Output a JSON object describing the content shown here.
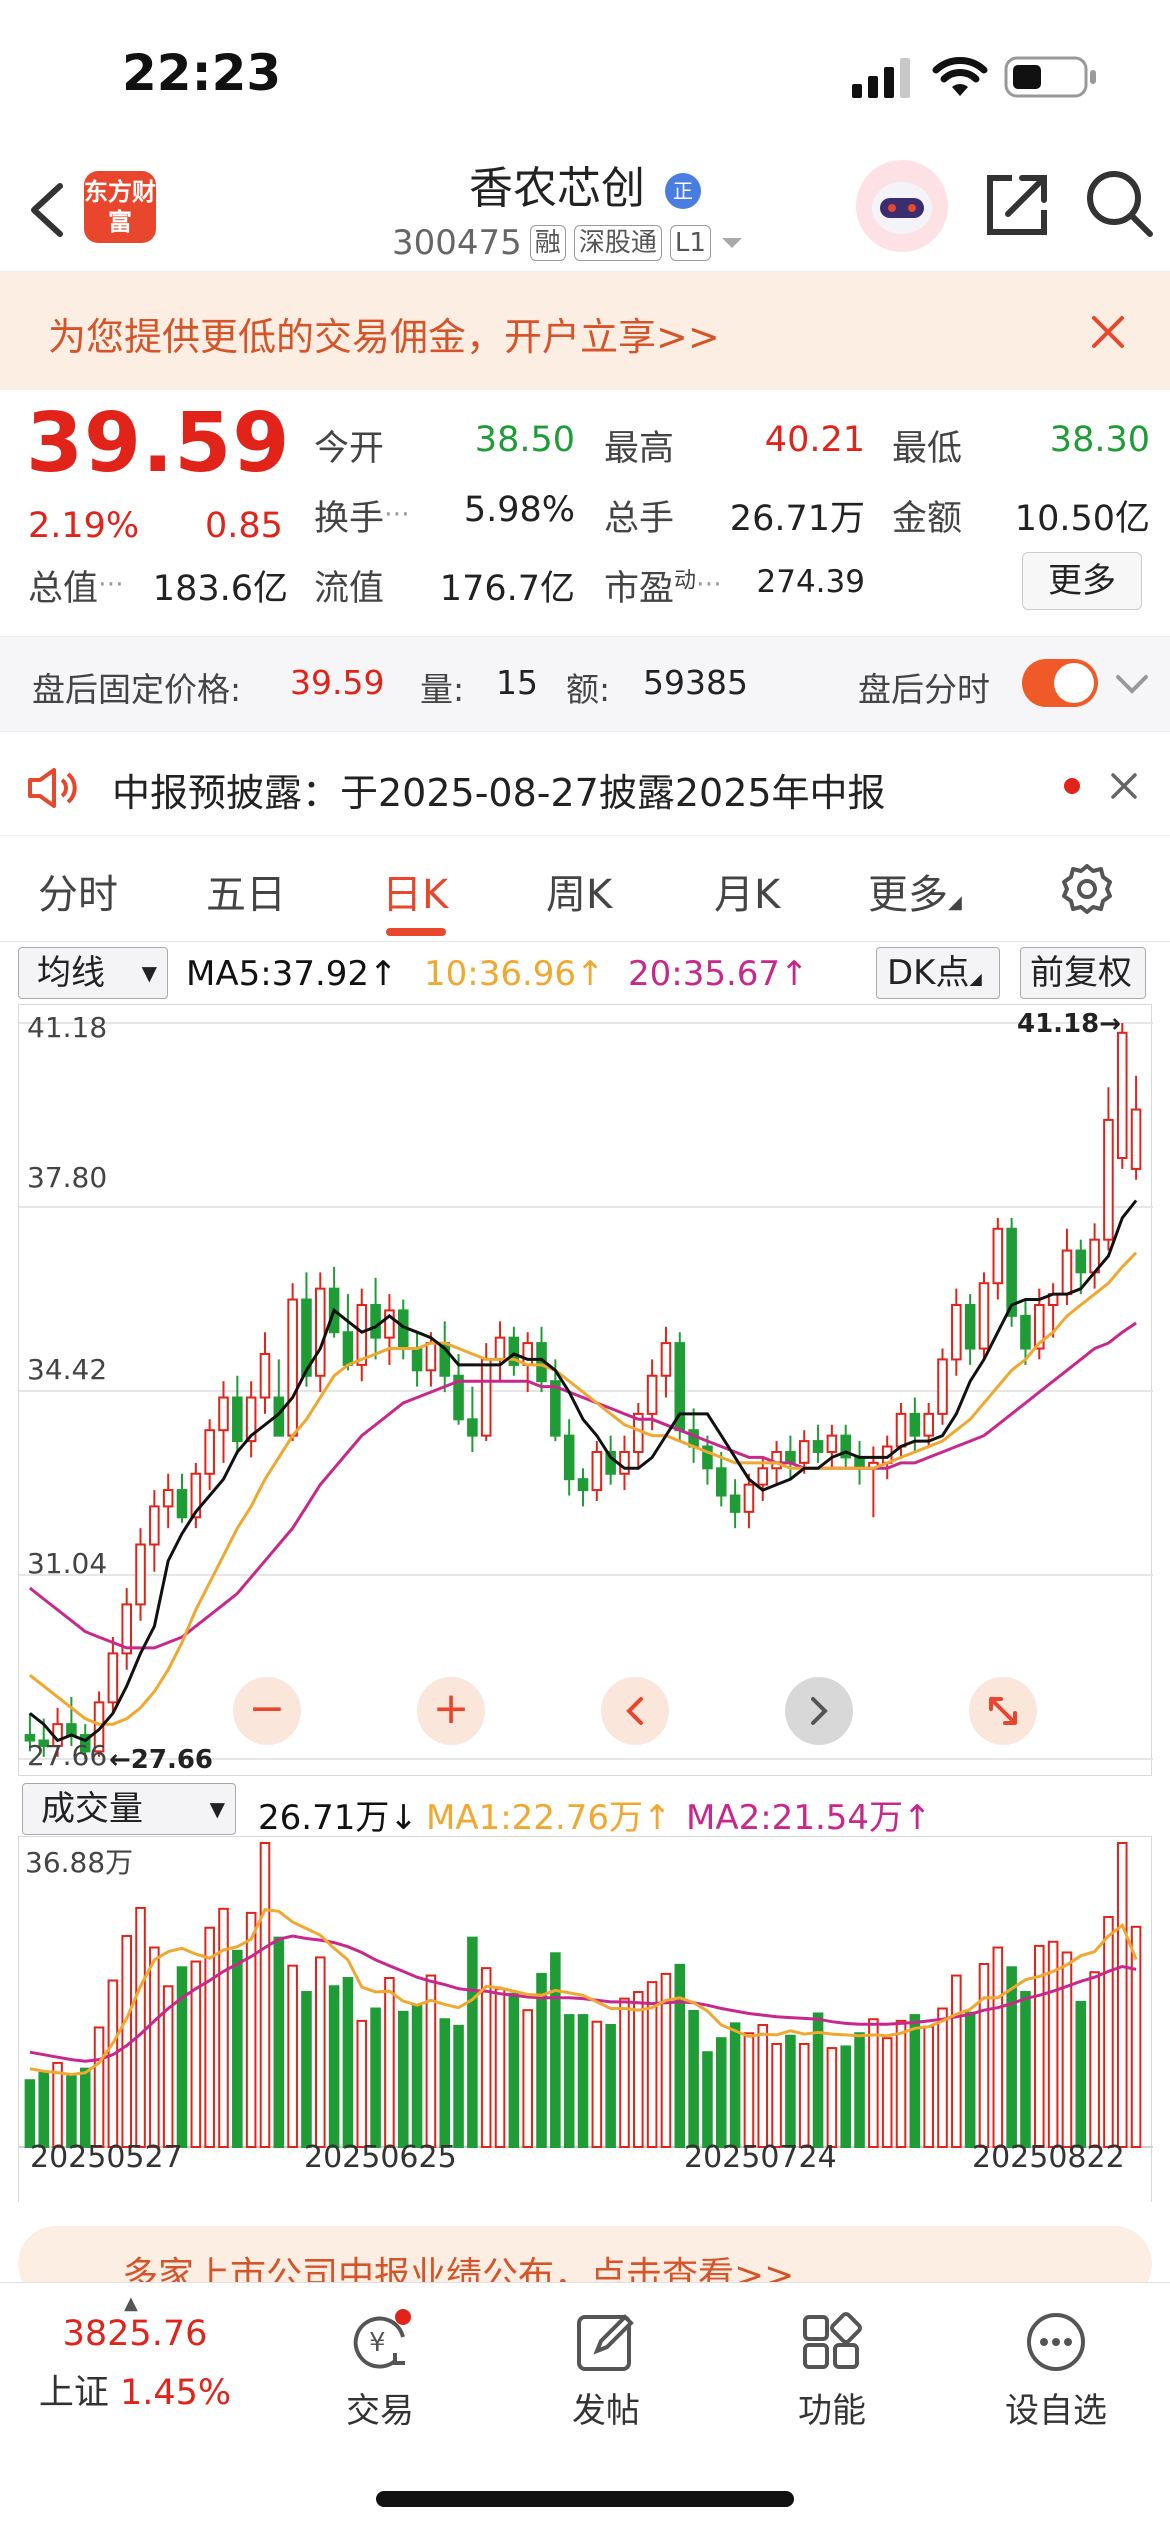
{
  "status_bar": {
    "time": "22:23"
  },
  "header": {
    "brand_logo_text": "东方财富",
    "stock_name": "香农芯创",
    "stock_name_badge": "正",
    "stock_code": "300475",
    "tags": [
      "融",
      "深股通",
      "L1"
    ]
  },
  "promo_banner": {
    "text": "为您提供更低的交易佣金，开户立享>>"
  },
  "quote": {
    "price": "39.59",
    "change_pct": "2.19%",
    "change_amt": "0.85",
    "fields": [
      {
        "label": "今开",
        "value": "38.50",
        "color": "#1f9c36"
      },
      {
        "label": "最高",
        "value": "40.21",
        "color": "#e2231a"
      },
      {
        "label": "最低",
        "value": "38.30",
        "color": "#1f9c36"
      },
      {
        "label": "换手",
        "value": "5.98%",
        "color": "#222222"
      },
      {
        "label": "总手",
        "value": "26.71万",
        "color": "#222222"
      },
      {
        "label": "金额",
        "value": "10.50亿",
        "color": "#222222"
      },
      {
        "label": "总值",
        "value": "183.6亿",
        "color": "#222222"
      },
      {
        "label": "流值",
        "value": "176.7亿",
        "color": "#222222"
      },
      {
        "label": "市盈",
        "label_sup": "动",
        "value": "274.39",
        "color": "#222222"
      }
    ],
    "more_label": "更多"
  },
  "after_hours": {
    "label": "盘后固定价格:",
    "price": "39.59",
    "vol_label": "量:",
    "vol": "15",
    "amt_label": "额:",
    "amt": "59385",
    "toggle_label": "盘后分时"
  },
  "notice": {
    "text": "中报预披露：于2025-08-27披露2025年中报"
  },
  "tabs": [
    "分时",
    "五日",
    "日K",
    "周K",
    "月K",
    "更多"
  ],
  "active_tab": "日K",
  "ma_row": {
    "selector": "均线",
    "ma5": "MA5:37.92↑",
    "ma10": "10:36.96↑",
    "ma20": "20:35.67↑",
    "dk_label": "DK点",
    "adjust_label": "前复权"
  },
  "vol_row": {
    "selector": "成交量",
    "vol": "26.71万↓",
    "ma1": "MA1:22.76万↑",
    "ma2": "MA2:21.54万↑"
  },
  "bottom_ad": {
    "text": "多家上市公司中报业绩公布，点击查看>>"
  },
  "bottom_nav": {
    "index_value": "3825.76",
    "index_name": "上证",
    "index_change": "1.45%",
    "items": [
      "交易",
      "发帖",
      "功能",
      "设自选"
    ]
  },
  "colors": {
    "up": "#e2231a",
    "down": "#1f9c36",
    "ma5": "#111111",
    "ma10": "#f0a830",
    "ma20": "#c8288c",
    "accent": "#e8462d"
  },
  "chart_data": {
    "type": "candlestick",
    "ylim": [
      27.66,
      41.18
    ],
    "y_ticks": [
      "41.18",
      "37.80",
      "34.42",
      "31.04",
      "27.66"
    ],
    "max_label": "41.18→",
    "min_label": "←27.66",
    "x_ticks": [
      "20250527",
      "20250625",
      "20250724",
      "20250822"
    ],
    "volume_max_label": "36.88万",
    "volume_max": 36.88,
    "candles": [
      [
        28.1,
        28.5,
        27.8,
        28.0
      ],
      [
        28.0,
        28.4,
        27.7,
        27.9
      ],
      [
        27.9,
        28.6,
        27.7,
        28.3
      ],
      [
        28.3,
        28.8,
        27.9,
        28.1
      ],
      [
        28.1,
        28.3,
        27.66,
        27.8
      ],
      [
        27.8,
        28.9,
        27.7,
        28.7
      ],
      [
        28.7,
        29.9,
        28.5,
        29.6
      ],
      [
        29.6,
        30.8,
        29.3,
        30.5
      ],
      [
        30.5,
        31.9,
        30.2,
        31.6
      ],
      [
        31.6,
        32.6,
        31.1,
        32.3
      ],
      [
        32.3,
        32.9,
        31.9,
        32.6
      ],
      [
        32.6,
        32.9,
        32.0,
        32.1
      ],
      [
        32.1,
        33.1,
        31.9,
        32.9
      ],
      [
        32.9,
        33.9,
        32.6,
        33.7
      ],
      [
        33.7,
        34.6,
        33.1,
        34.3
      ],
      [
        34.3,
        34.7,
        33.3,
        33.5
      ],
      [
        33.5,
        34.6,
        33.2,
        34.3
      ],
      [
        34.3,
        35.5,
        34.0,
        35.1
      ],
      [
        34.3,
        35.0,
        33.6,
        33.6
      ],
      [
        33.6,
        36.4,
        33.5,
        36.1
      ],
      [
        36.1,
        36.6,
        34.5,
        34.7
      ],
      [
        34.7,
        36.6,
        34.4,
        36.3
      ],
      [
        36.3,
        36.7,
        35.4,
        35.5
      ],
      [
        35.5,
        36.2,
        34.8,
        34.9
      ],
      [
        34.9,
        36.3,
        34.6,
        36.0
      ],
      [
        36.0,
        36.5,
        35.0,
        35.4
      ],
      [
        35.4,
        36.2,
        34.9,
        35.9
      ],
      [
        35.9,
        36.1,
        35.0,
        35.2
      ],
      [
        35.2,
        35.5,
        34.5,
        34.8
      ],
      [
        34.8,
        35.5,
        34.5,
        35.3
      ],
      [
        35.3,
        35.7,
        34.4,
        34.7
      ],
      [
        34.7,
        35.1,
        33.8,
        33.9
      ],
      [
        33.9,
        34.5,
        33.3,
        33.6
      ],
      [
        33.6,
        35.3,
        33.5,
        35.0
      ],
      [
        35.0,
        35.7,
        34.6,
        35.4
      ],
      [
        35.4,
        35.6,
        34.7,
        34.9
      ],
      [
        34.9,
        35.5,
        34.4,
        35.3
      ],
      [
        35.3,
        35.6,
        34.4,
        34.6
      ],
      [
        34.6,
        35.0,
        33.5,
        33.6
      ],
      [
        33.6,
        33.9,
        32.5,
        32.8
      ],
      [
        32.8,
        33.0,
        32.3,
        32.6
      ],
      [
        32.6,
        33.5,
        32.4,
        33.3
      ],
      [
        33.3,
        33.6,
        32.7,
        32.9
      ],
      [
        32.9,
        33.6,
        32.6,
        33.3
      ],
      [
        33.3,
        34.2,
        33.0,
        34.0
      ],
      [
        34.0,
        35.0,
        33.7,
        34.7
      ],
      [
        34.7,
        35.6,
        34.3,
        35.3
      ],
      [
        35.3,
        35.5,
        33.5,
        33.7
      ],
      [
        33.7,
        34.1,
        33.1,
        33.4
      ],
      [
        33.4,
        33.6,
        32.7,
        33.0
      ],
      [
        33.0,
        33.3,
        32.3,
        32.5
      ],
      [
        32.5,
        32.8,
        31.9,
        32.2
      ],
      [
        32.2,
        32.9,
        31.9,
        32.7
      ],
      [
        32.7,
        33.2,
        32.4,
        33.0
      ],
      [
        33.0,
        33.5,
        32.7,
        33.3
      ],
      [
        33.3,
        33.6,
        32.8,
        33.1
      ],
      [
        33.1,
        33.7,
        32.9,
        33.5
      ],
      [
        33.5,
        33.8,
        33.1,
        33.3
      ],
      [
        33.3,
        33.8,
        33.0,
        33.6
      ],
      [
        33.6,
        33.8,
        33.0,
        33.2
      ],
      [
        33.2,
        33.5,
        32.7,
        33.0
      ],
      [
        33.0,
        33.4,
        32.1,
        33.1
      ],
      [
        33.1,
        33.6,
        32.8,
        33.4
      ],
      [
        33.4,
        34.2,
        33.2,
        34.0
      ],
      [
        34.0,
        34.3,
        33.3,
        33.6
      ],
      [
        33.6,
        34.2,
        33.4,
        34.0
      ],
      [
        34.0,
        35.2,
        33.8,
        35.0
      ],
      [
        35.0,
        36.3,
        34.7,
        36.0
      ],
      [
        36.0,
        36.2,
        34.9,
        35.2
      ],
      [
        35.2,
        36.6,
        35.0,
        36.4
      ],
      [
        36.4,
        37.6,
        36.1,
        37.4
      ],
      [
        37.4,
        37.6,
        35.6,
        35.8
      ],
      [
        35.8,
        36.1,
        34.9,
        35.2
      ],
      [
        35.2,
        36.3,
        35.0,
        36.0
      ],
      [
        36.0,
        36.4,
        35.4,
        36.2
      ],
      [
        36.2,
        37.4,
        36.0,
        37.0
      ],
      [
        37.0,
        37.2,
        36.2,
        36.6
      ],
      [
        36.6,
        37.5,
        36.3,
        37.2
      ],
      [
        37.2,
        40.0,
        37.0,
        39.4
      ],
      [
        38.7,
        41.18,
        38.5,
        41.0
      ],
      [
        38.5,
        40.21,
        38.3,
        39.59
      ]
    ],
    "volume": [
      8.1,
      9.0,
      10.2,
      8.8,
      9.5,
      14.5,
      20.2,
      25.6,
      29.0,
      24.2,
      19.5,
      21.8,
      22.5,
      26.6,
      28.9,
      23.8,
      28.4,
      36.88,
      25.4,
      22.0,
      18.8,
      23.0,
      19.5,
      20.5,
      15.3,
      16.8,
      20.5,
      16.4,
      17.2,
      20.8,
      15.5,
      14.7,
      25.4,
      21.7,
      19.2,
      18.6,
      16.6,
      21.0,
      23.5,
      16.0,
      16.0,
      15.2,
      14.8,
      18.0,
      18.8,
      20.0,
      21.0,
      22.1,
      16.5,
      11.5,
      13.2,
      15.0,
      13.8,
      14.8,
      12.5,
      13.5,
      12.5,
      16.2,
      12.0,
      12.2,
      13.8,
      15.5,
      13.2,
      15.3,
      16.0,
      14.6,
      16.8,
      20.8,
      16.3,
      22.2,
      24.2,
      21.8,
      18.8,
      24.4,
      24.9,
      23.6,
      17.6,
      21.2,
      27.9,
      36.88,
      26.71
    ],
    "ma5": [
      28.5,
      28.3,
      28.0,
      28.1,
      28.0,
      28.2,
      28.5,
      29.0,
      29.6,
      30.1,
      31.3,
      31.8,
      32.2,
      32.5,
      32.8,
      33.3,
      33.6,
      33.8,
      34.0,
      34.3,
      34.8,
      35.2,
      35.9,
      35.7,
      35.5,
      35.6,
      35.8,
      35.6,
      35.5,
      35.4,
      35.2,
      34.9,
      34.9,
      34.9,
      34.9,
      35.1,
      35.0,
      35.0,
      34.8,
      34.4,
      33.9,
      33.6,
      33.2,
      33.0,
      33.0,
      33.2,
      33.6,
      34.0,
      34.0,
      34.0,
      33.6,
      33.2,
      32.8,
      32.6,
      32.7,
      32.8,
      33.0,
      33.0,
      33.2,
      33.3,
      33.2,
      33.2,
      33.2,
      33.4,
      33.5,
      33.5,
      33.6,
      34.0,
      34.6,
      35.0,
      35.5,
      36.0,
      36.1,
      36.1,
      36.2,
      36.2,
      36.3,
      36.6,
      36.9,
      37.6,
      37.92
    ],
    "ma10": [
      29.2,
      29.0,
      28.8,
      28.6,
      28.4,
      28.3,
      28.3,
      28.4,
      28.6,
      28.9,
      29.3,
      29.8,
      30.4,
      30.9,
      31.4,
      31.9,
      32.3,
      32.8,
      33.2,
      33.6,
      33.9,
      34.3,
      34.7,
      34.9,
      35.0,
      35.1,
      35.2,
      35.2,
      35.2,
      35.3,
      35.3,
      35.2,
      35.1,
      35.0,
      35.0,
      35.0,
      34.9,
      34.9,
      34.8,
      34.6,
      34.4,
      34.2,
      34.0,
      33.8,
      33.7,
      33.6,
      33.6,
      33.5,
      33.4,
      33.3,
      33.2,
      33.1,
      33.1,
      33.1,
      33.1,
      33.0,
      33.0,
      33.0,
      33.0,
      33.0,
      33.0,
      33.0,
      33.1,
      33.2,
      33.3,
      33.4,
      33.5,
      33.7,
      33.9,
      34.2,
      34.5,
      34.8,
      35.0,
      35.3,
      35.5,
      35.8,
      36.0,
      36.2,
      36.4,
      36.7,
      36.96
    ],
    "ma20": [
      30.8,
      30.6,
      30.4,
      30.2,
      30.0,
      29.9,
      29.8,
      29.7,
      29.7,
      29.7,
      29.8,
      29.9,
      30.1,
      30.3,
      30.5,
      30.7,
      31.0,
      31.3,
      31.6,
      31.9,
      32.3,
      32.7,
      33.0,
      33.3,
      33.6,
      33.8,
      34.0,
      34.2,
      34.3,
      34.4,
      34.5,
      34.6,
      34.6,
      34.6,
      34.6,
      34.6,
      34.6,
      34.5,
      34.5,
      34.4,
      34.3,
      34.2,
      34.1,
      34.0,
      33.9,
      33.9,
      33.8,
      33.7,
      33.6,
      33.5,
      33.4,
      33.3,
      33.2,
      33.2,
      33.1,
      33.1,
      33.0,
      33.0,
      33.0,
      33.0,
      33.0,
      33.0,
      33.0,
      33.1,
      33.1,
      33.2,
      33.3,
      33.4,
      33.5,
      33.6,
      33.8,
      34.0,
      34.2,
      34.4,
      34.6,
      34.8,
      35.0,
      35.2,
      35.3,
      35.5,
      35.67
    ],
    "vol_ma1": [
      9.5,
      9.2,
      9.0,
      8.8,
      9.0,
      10.2,
      12.6,
      15.6,
      19.5,
      22.7,
      23.7,
      24.1,
      23.4,
      22.9,
      23.9,
      24.3,
      25.2,
      28.8,
      28.6,
      27.3,
      26.5,
      25.7,
      24.1,
      22.7,
      19.4,
      18.8,
      18.9,
      17.7,
      17.2,
      17.8,
      17.3,
      16.9,
      17.9,
      19.5,
      19.3,
      18.9,
      18.5,
      18.4,
      19.0,
      18.7,
      18.4,
      17.6,
      16.8,
      16.8,
      16.6,
      16.9,
      17.8,
      18.1,
      17.5,
      16.5,
      14.8,
      14.1,
      13.4,
      13.7,
      13.6,
      14.1,
      13.7,
      13.9,
      13.7,
      13.6,
      13.5,
      13.6,
      13.5,
      13.8,
      14.4,
      14.6,
      15.3,
      16.1,
      16.7,
      18.1,
      18.1,
      19.2,
      20.3,
      20.7,
      21.3,
      22.1,
      23.2,
      23.7,
      25.6,
      26.9,
      22.76
    ],
    "vol_ma2": [
      11.5,
      11.2,
      10.9,
      10.6,
      10.4,
      10.6,
      11.2,
      12.3,
      13.7,
      15.3,
      16.8,
      18.1,
      19.2,
      20.2,
      21.3,
      22.2,
      23.1,
      24.2,
      25.2,
      25.6,
      25.3,
      25.1,
      24.8,
      24.3,
      23.6,
      22.7,
      22.0,
      21.3,
      20.6,
      20.1,
      19.7,
      19.2,
      19.0,
      18.9,
      18.6,
      18.4,
      18.2,
      18.1,
      18.1,
      18.1,
      18.0,
      17.8,
      17.6,
      17.6,
      17.5,
      17.4,
      17.5,
      17.6,
      17.5,
      17.2,
      16.8,
      16.5,
      16.2,
      16.0,
      15.8,
      15.7,
      15.6,
      15.5,
      15.2,
      15.0,
      14.9,
      14.9,
      14.9,
      15.0,
      15.1,
      15.3,
      15.5,
      15.8,
      16.1,
      16.6,
      16.9,
      17.4,
      18.0,
      18.4,
      18.9,
      19.5,
      20.1,
      20.6,
      21.3,
      21.9,
      21.54
    ]
  }
}
